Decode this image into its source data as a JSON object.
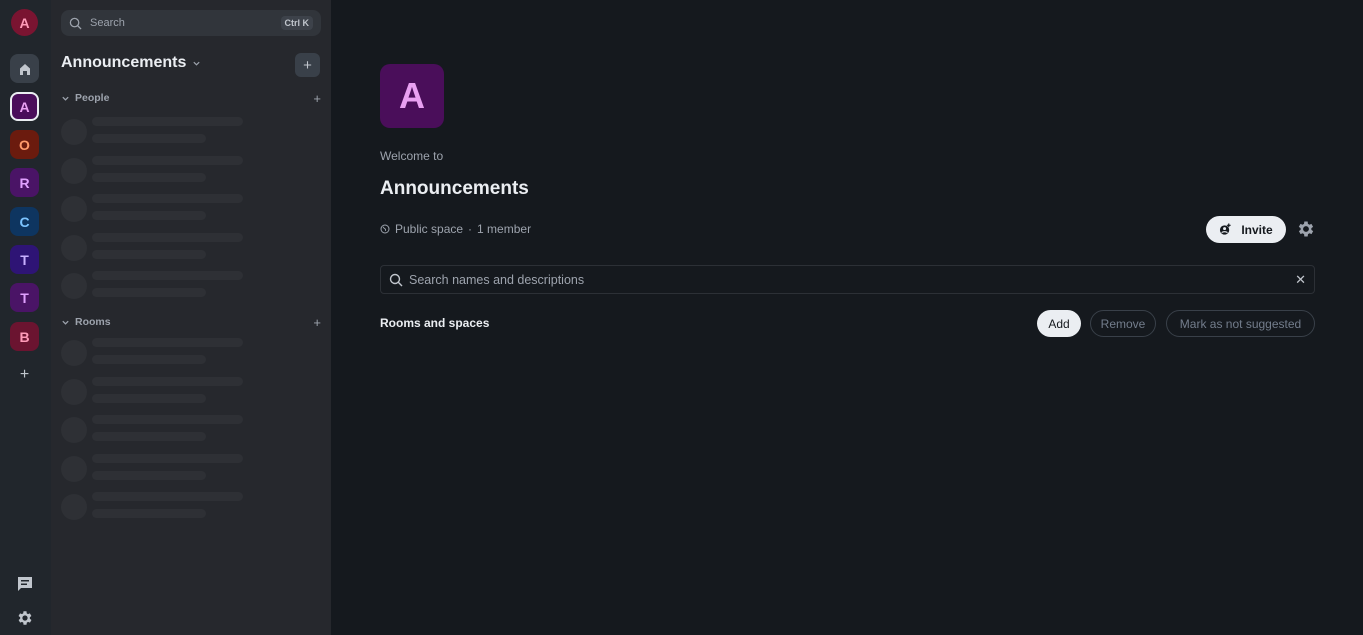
{
  "rail": {
    "user_initial": "A",
    "spaces": [
      {
        "initial": "A",
        "bg": "#4a0e5a",
        "fg": "#e9a0f2",
        "active": true
      },
      {
        "initial": "O",
        "bg": "#6b1b0e",
        "fg": "#ff9a6b",
        "active": false
      },
      {
        "initial": "R",
        "bg": "#4a1466",
        "fg": "#e0a0ff",
        "active": false
      },
      {
        "initial": "C",
        "bg": "#0e3560",
        "fg": "#7cc4ff",
        "active": false
      },
      {
        "initial": "T",
        "bg": "#2e1475",
        "fg": "#c8b0ff",
        "active": false
      },
      {
        "initial": "T",
        "bg": "#4a1466",
        "fg": "#e0a0ff",
        "active": false
      },
      {
        "initial": "B",
        "bg": "#6b1430",
        "fg": "#ff9bb8",
        "active": false
      }
    ],
    "add_symbol": "+"
  },
  "sidebar": {
    "search_label": "Search",
    "search_shortcut": "Ctrl K",
    "space_name": "Announcements",
    "add_symbol": "+",
    "sections": {
      "people": "People",
      "rooms": "Rooms"
    }
  },
  "main": {
    "avatar_initial": "A",
    "welcome": "Welcome to",
    "title": "Announcements",
    "visibility": "Public space",
    "separator": "·",
    "members": "1 member",
    "invite_label": "Invite",
    "search_placeholder": "Search names and descriptions",
    "clear_symbol": "✕",
    "rooms_and_spaces": "Rooms and spaces",
    "add_label": "Add",
    "remove_label": "Remove",
    "mark_label": "Mark as not suggested"
  }
}
